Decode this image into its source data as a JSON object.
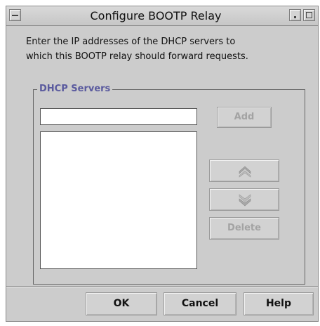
{
  "window": {
    "title": "Configure BOOTP Relay"
  },
  "instruction": {
    "line1": "Enter the IP addresses of the DHCP servers to",
    "line2": "which this BOOTP relay should forward requests."
  },
  "servers_group": {
    "title": "DHCP Servers",
    "input_value": "",
    "list_items": []
  },
  "buttons": {
    "add": "Add",
    "delete": "Delete",
    "ok": "OK",
    "cancel": "Cancel",
    "help": "Help"
  },
  "icons": {
    "move_up": "chevron-up-double-icon",
    "move_down": "chevron-down-double-icon"
  },
  "colors": {
    "group_title": "#5a5a9e",
    "disabled_text": "#a3a3a3",
    "window_bg": "#cccccc"
  }
}
